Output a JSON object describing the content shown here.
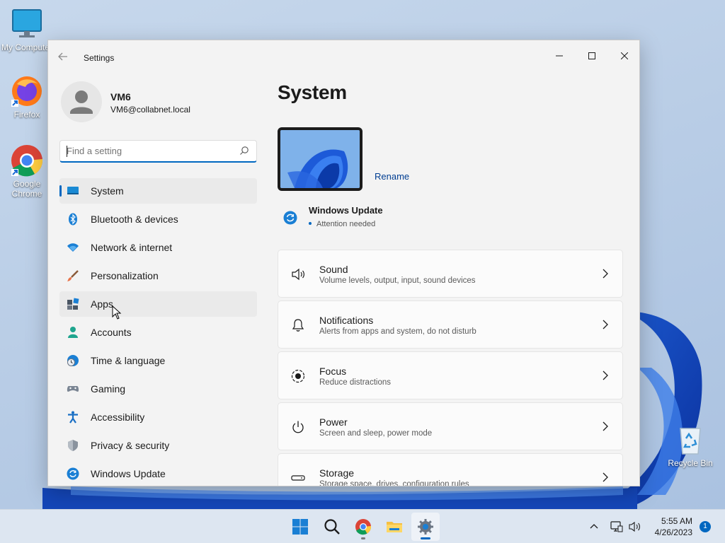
{
  "desktop": {
    "icons": [
      {
        "label": "My Computer",
        "icon": "monitor-icon"
      },
      {
        "label": "Firefox",
        "icon": "firefox-icon"
      },
      {
        "label": "Google Chrome",
        "icon": "chrome-icon"
      },
      {
        "label": "Recycle Bin",
        "icon": "recycle-bin-icon"
      }
    ]
  },
  "window": {
    "title": "Settings",
    "controls": {
      "minimize": "—",
      "maximize": "☐",
      "close": "✕"
    }
  },
  "profile": {
    "name": "VM6",
    "email": "VM6@collabnet.local"
  },
  "search": {
    "placeholder": "Find a setting"
  },
  "nav": {
    "items": [
      {
        "label": "System",
        "icon": "system-icon",
        "selected": true
      },
      {
        "label": "Bluetooth & devices",
        "icon": "bluetooth-icon"
      },
      {
        "label": "Network & internet",
        "icon": "wifi-icon"
      },
      {
        "label": "Personalization",
        "icon": "brush-icon"
      },
      {
        "label": "Apps",
        "icon": "apps-icon",
        "hovered": true
      },
      {
        "label": "Accounts",
        "icon": "person-icon"
      },
      {
        "label": "Time & language",
        "icon": "globe-clock-icon"
      },
      {
        "label": "Gaming",
        "icon": "gamepad-icon"
      },
      {
        "label": "Accessibility",
        "icon": "accessibility-icon"
      },
      {
        "label": "Privacy & security",
        "icon": "shield-icon"
      },
      {
        "label": "Windows Update",
        "icon": "update-icon"
      }
    ]
  },
  "main": {
    "title": "System",
    "rename_label": "Rename",
    "windows_update": {
      "title": "Windows Update",
      "status": "Attention needed"
    },
    "cards": [
      {
        "title": "Sound",
        "desc": "Volume levels, output, input, sound devices",
        "icon": "speaker-icon"
      },
      {
        "title": "Notifications",
        "desc": "Alerts from apps and system, do not disturb",
        "icon": "bell-icon"
      },
      {
        "title": "Focus",
        "desc": "Reduce distractions",
        "icon": "focus-icon"
      },
      {
        "title": "Power",
        "desc": "Screen and sleep, power mode",
        "icon": "power-icon"
      },
      {
        "title": "Storage",
        "desc": "Storage space, drives, configuration rules",
        "icon": "storage-icon"
      }
    ]
  },
  "taskbar": {
    "apps": [
      "start-icon",
      "search-icon",
      "chrome-icon",
      "file-explorer-icon",
      "settings-icon"
    ],
    "time": "5:55 AM",
    "date": "4/26/2023",
    "notification_count": "1"
  },
  "colors": {
    "accent": "#0067c0",
    "window_bg": "#f3f3f3",
    "card_bg": "#fbfbfb"
  }
}
